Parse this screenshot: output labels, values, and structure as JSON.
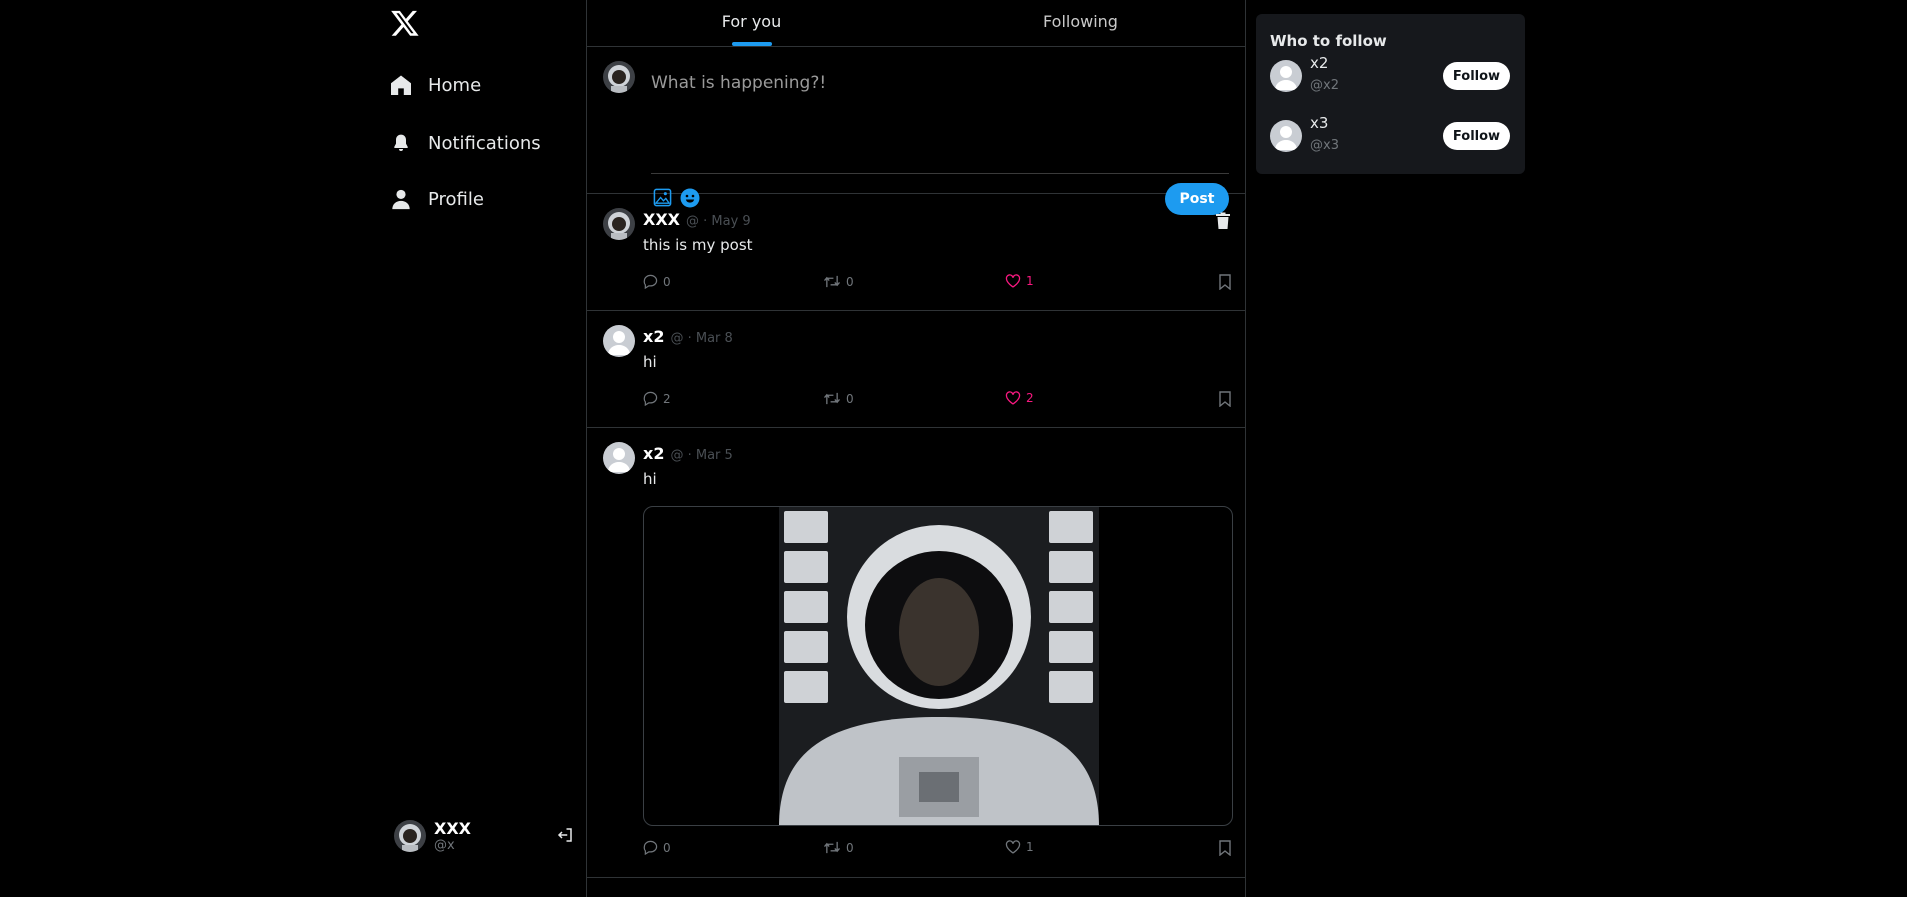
{
  "sidebar": {
    "nav": [
      {
        "label": "Home",
        "icon": "home-icon"
      },
      {
        "label": "Notifications",
        "icon": "bell-icon"
      },
      {
        "label": "Profile",
        "icon": "user-icon"
      }
    ],
    "account": {
      "name": "XXX",
      "handle": "@x"
    }
  },
  "tabs": [
    {
      "label": "For you",
      "active": true
    },
    {
      "label": "Following",
      "active": false
    }
  ],
  "composer": {
    "placeholder": "What is happening?!",
    "post_label": "Post",
    "tools": [
      "image-icon",
      "emoji-icon"
    ]
  },
  "posts": [
    {
      "author": "XXX",
      "meta": "@ · May 9",
      "text": "this is my post",
      "replies": "0",
      "reposts": "0",
      "likes": "1",
      "liked": true,
      "deletable": true,
      "has_image": false
    },
    {
      "author": "x2",
      "meta": "@ · Mar 8",
      "text": "hi",
      "replies": "2",
      "reposts": "0",
      "likes": "2",
      "liked": true,
      "deletable": false,
      "has_image": false
    },
    {
      "author": "x2",
      "meta": "@ · Mar 5",
      "text": "hi",
      "replies": "0",
      "reposts": "0",
      "likes": "1",
      "liked": false,
      "deletable": false,
      "has_image": true
    }
  ],
  "who_to_follow": {
    "title": "Who to follow",
    "users": [
      {
        "name": "x2",
        "handle": "@x2",
        "button": "Follow"
      },
      {
        "name": "x3",
        "handle": "@x3",
        "button": "Follow"
      }
    ]
  },
  "colors": {
    "accent": "#1d9bf0",
    "like": "#f91880",
    "background": "#000000",
    "panel": "#16181c"
  }
}
